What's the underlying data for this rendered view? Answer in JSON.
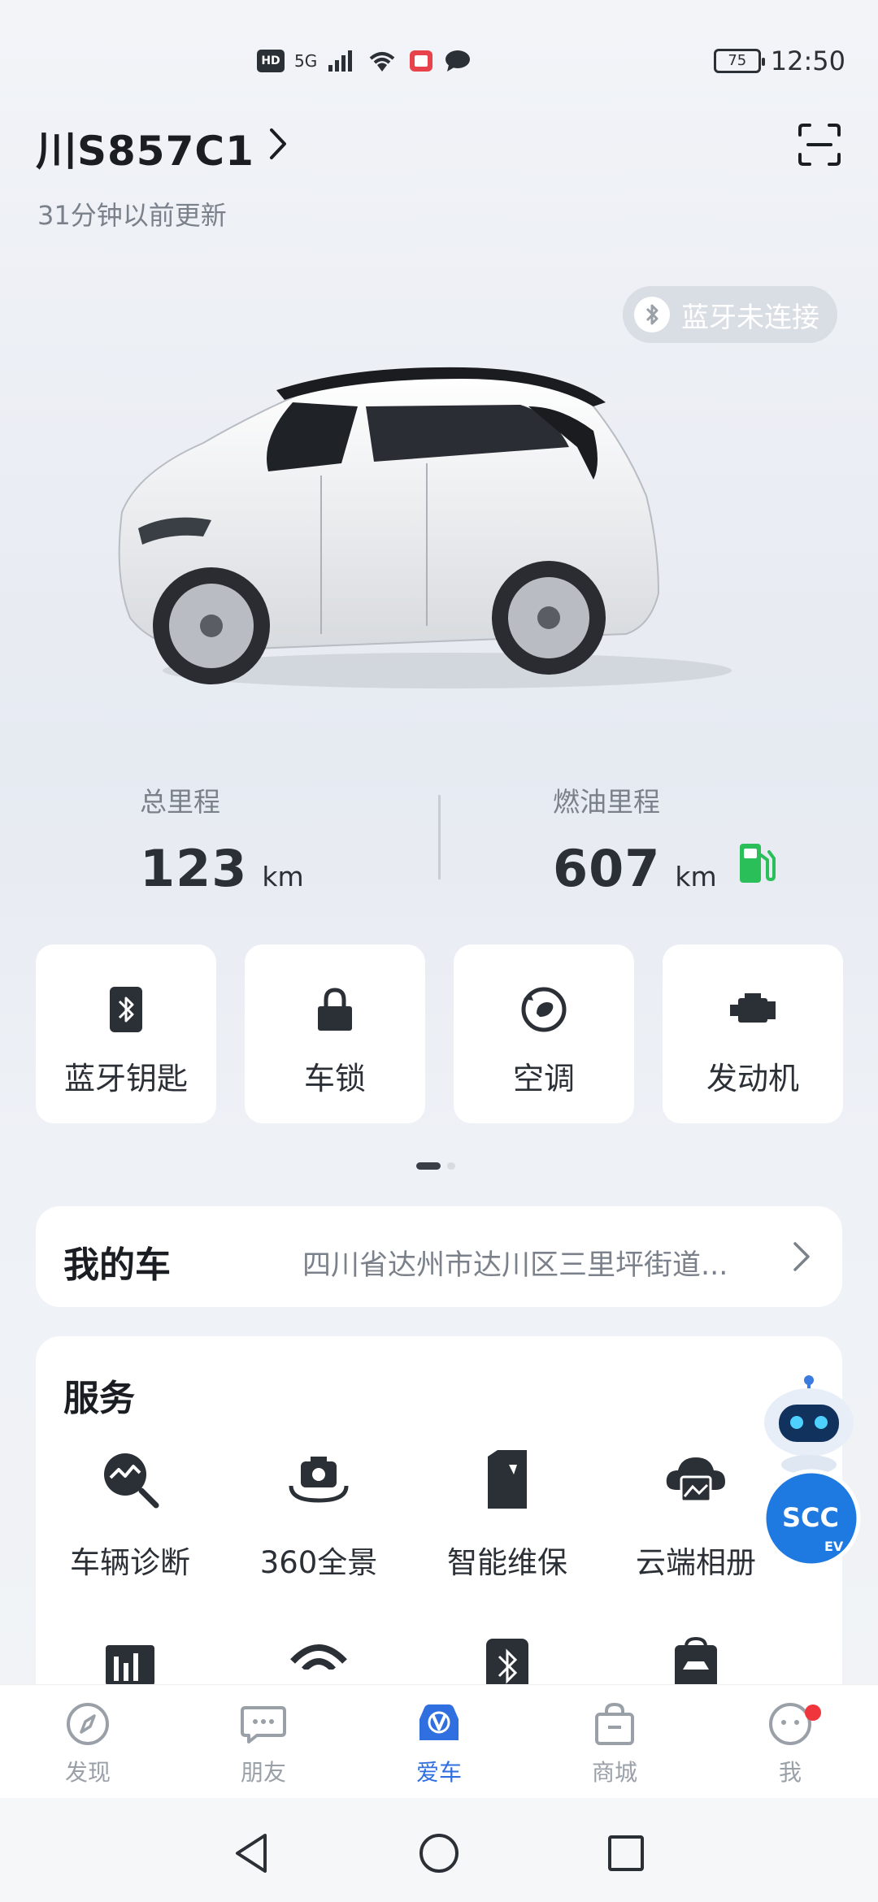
{
  "status_bar": {
    "hd": "HD",
    "network": "5G",
    "battery": "75",
    "time": "12:50"
  },
  "header": {
    "plate": "川S857C1",
    "updated": "31分钟以前更新"
  },
  "bluetooth_status": "蓝牙未连接",
  "mileage": {
    "total_label": "总里程",
    "total_value": "123",
    "total_unit": "km",
    "fuel_label": "燃油里程",
    "fuel_value": "607",
    "fuel_unit": "km"
  },
  "controls": [
    {
      "label": "蓝牙钥匙",
      "icon": "bluetooth-key-icon"
    },
    {
      "label": "车锁",
      "icon": "lock-icon"
    },
    {
      "label": "空调",
      "icon": "ac-icon"
    },
    {
      "label": "发动机",
      "icon": "engine-icon"
    }
  ],
  "my_car": {
    "title": "我的车",
    "address": "四川省达州市达川区三里坪街道..."
  },
  "services": {
    "title": "服务",
    "items": [
      {
        "label": "车辆诊断",
        "icon": "diagnosis-icon"
      },
      {
        "label": "360全景",
        "icon": "camera-360-icon"
      },
      {
        "label": "智能维保",
        "icon": "maintenance-icon"
      },
      {
        "label": "云端相册",
        "icon": "cloud-album-icon"
      }
    ]
  },
  "tabs": [
    {
      "label": "发现",
      "icon": "compass-icon",
      "active": false
    },
    {
      "label": "朋友",
      "icon": "chat-icon",
      "active": false
    },
    {
      "label": "爱车",
      "icon": "car-icon",
      "active": true
    },
    {
      "label": "商城",
      "icon": "shopping-bag-icon",
      "active": false
    },
    {
      "label": "我",
      "icon": "profile-icon",
      "active": false
    }
  ],
  "colors": {
    "accent": "#2f6fe0",
    "fuel_green": "#2bbf5a",
    "badge_red": "#f0353d",
    "text_dark": "#1a1d22",
    "text_muted": "#7b818a"
  }
}
